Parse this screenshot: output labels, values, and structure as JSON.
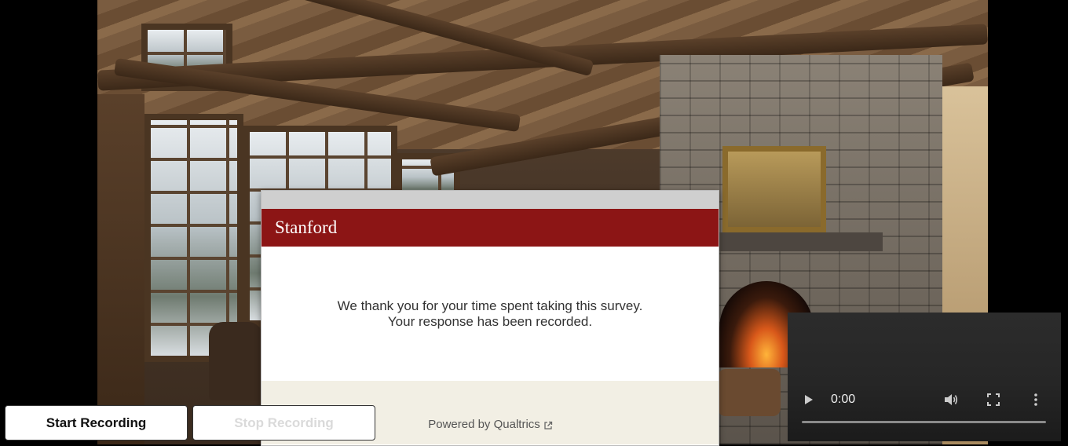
{
  "card": {
    "brand": "Stanford",
    "message_line1": "We thank you for your time spent taking this survey.",
    "message_line2": "Your response has been recorded.",
    "footer_text": "Powered by Qualtrics",
    "footer_icon": "external-link-icon",
    "brand_color": "#8c1515"
  },
  "recording": {
    "start_label": "Start Recording",
    "stop_label": "Stop Recording",
    "stop_disabled": true
  },
  "video": {
    "time": "0:00",
    "play_icon": "play-icon",
    "volume_icon": "volume-icon",
    "fullscreen_icon": "fullscreen-icon",
    "more_icon": "more-options-icon"
  }
}
